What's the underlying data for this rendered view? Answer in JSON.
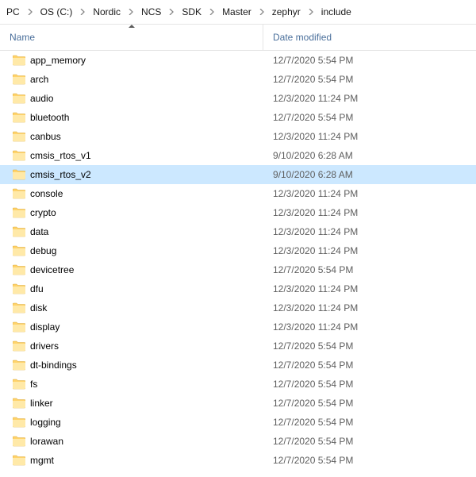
{
  "breadcrumb": [
    "PC",
    "OS (C:)",
    "Nordic",
    "NCS",
    "SDK",
    "Master",
    "zephyr",
    "include"
  ],
  "columns": {
    "name": "Name",
    "date": "Date modified"
  },
  "selected_index": 6,
  "items": [
    {
      "name": "app_memory",
      "date": "12/7/2020 5:54 PM"
    },
    {
      "name": "arch",
      "date": "12/7/2020 5:54 PM"
    },
    {
      "name": "audio",
      "date": "12/3/2020 11:24 PM"
    },
    {
      "name": "bluetooth",
      "date": "12/7/2020 5:54 PM"
    },
    {
      "name": "canbus",
      "date": "12/3/2020 11:24 PM"
    },
    {
      "name": "cmsis_rtos_v1",
      "date": "9/10/2020 6:28 AM"
    },
    {
      "name": "cmsis_rtos_v2",
      "date": "9/10/2020 6:28 AM"
    },
    {
      "name": "console",
      "date": "12/3/2020 11:24 PM"
    },
    {
      "name": "crypto",
      "date": "12/3/2020 11:24 PM"
    },
    {
      "name": "data",
      "date": "12/3/2020 11:24 PM"
    },
    {
      "name": "debug",
      "date": "12/3/2020 11:24 PM"
    },
    {
      "name": "devicetree",
      "date": "12/7/2020 5:54 PM"
    },
    {
      "name": "dfu",
      "date": "12/3/2020 11:24 PM"
    },
    {
      "name": "disk",
      "date": "12/3/2020 11:24 PM"
    },
    {
      "name": "display",
      "date": "12/3/2020 11:24 PM"
    },
    {
      "name": "drivers",
      "date": "12/7/2020 5:54 PM"
    },
    {
      "name": "dt-bindings",
      "date": "12/7/2020 5:54 PM"
    },
    {
      "name": "fs",
      "date": "12/7/2020 5:54 PM"
    },
    {
      "name": "linker",
      "date": "12/7/2020 5:54 PM"
    },
    {
      "name": "logging",
      "date": "12/7/2020 5:54 PM"
    },
    {
      "name": "lorawan",
      "date": "12/7/2020 5:54 PM"
    },
    {
      "name": "mgmt",
      "date": "12/7/2020 5:54 PM"
    }
  ]
}
